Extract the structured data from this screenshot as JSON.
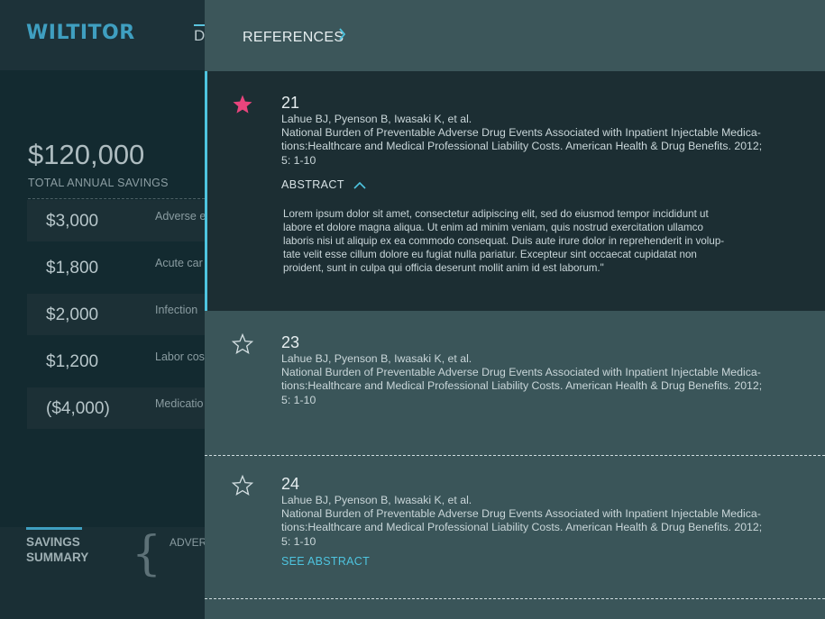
{
  "app": {
    "logo": "WILTITOR",
    "header_tab": "D"
  },
  "summary": {
    "total_amount": "$120,000",
    "total_label": "TOTAL ANNUAL SAVINGS",
    "rows": [
      {
        "value": "$3,000",
        "desc": "Adverse e"
      },
      {
        "value": "$1,800",
        "desc": "Acute car"
      },
      {
        "value": "$2,000",
        "desc": "Infection"
      },
      {
        "value": "$1,200",
        "desc": "Labor cos"
      },
      {
        "value": "($4,000)",
        "desc": "Medicatio"
      }
    ],
    "bottom_label": "SAVINGS SUMMARY",
    "bottom_tab": "ADVER"
  },
  "panel": {
    "title": "REFERENCES",
    "abstract_label": "ABSTRACT",
    "see_abstract": "SEE ABSTRACT",
    "references": [
      {
        "number": "21",
        "starred": true,
        "authors": "Lahue BJ, Pyenson B, Iwasaki K, et al.",
        "line1": "National Burden of Preventable Adverse Drug Events Associated with Inpatient Injectable Medica-",
        "line2": "tions:Healthcare and Medical Professional Liability Costs. American Health & Drug Benefits. 2012;",
        "line3": "5: 1-10",
        "abstract": [
          "Lorem ipsum dolor sit amet, consectetur adipiscing elit, sed do eiusmod tempor incididunt ut",
          "labore et dolore magna aliqua. Ut enim ad minim veniam, quis nostrud exercitation ullamco",
          "laboris nisi ut aliquip ex ea commodo consequat. Duis aute irure dolor in reprehenderit in volup-",
          "tate velit esse cillum dolore eu fugiat nulla pariatur. Excepteur sint occaecat cupidatat non",
          "proident, sunt in culpa qui officia deserunt mollit anim id est laborum.\""
        ]
      },
      {
        "number": "23",
        "starred": false,
        "authors": "Lahue BJ, Pyenson B, Iwasaki K, et al.",
        "line1": "National Burden of Preventable Adverse Drug Events Associated with Inpatient Injectable Medica-",
        "line2": "tions:Healthcare and Medical Professional Liability Costs. American Health & Drug Benefits. 2012;",
        "line3": "5: 1-10"
      },
      {
        "number": "24",
        "starred": false,
        "authors": "Lahue BJ, Pyenson B, Iwasaki K, et al.",
        "line1": "National Burden of Preventable Adverse Drug Events Associated with Inpatient Injectable Medica-",
        "line2": "tions:Healthcare and Medical Professional Liability Costs. American Health & Drug Benefits. 2012;",
        "line3": "5: 1-10"
      }
    ]
  },
  "colors": {
    "accent": "#4ec4df",
    "star_active": "#e8457d",
    "panel_bg": "#3a5559",
    "active_item_bg": "#1c2e33"
  }
}
